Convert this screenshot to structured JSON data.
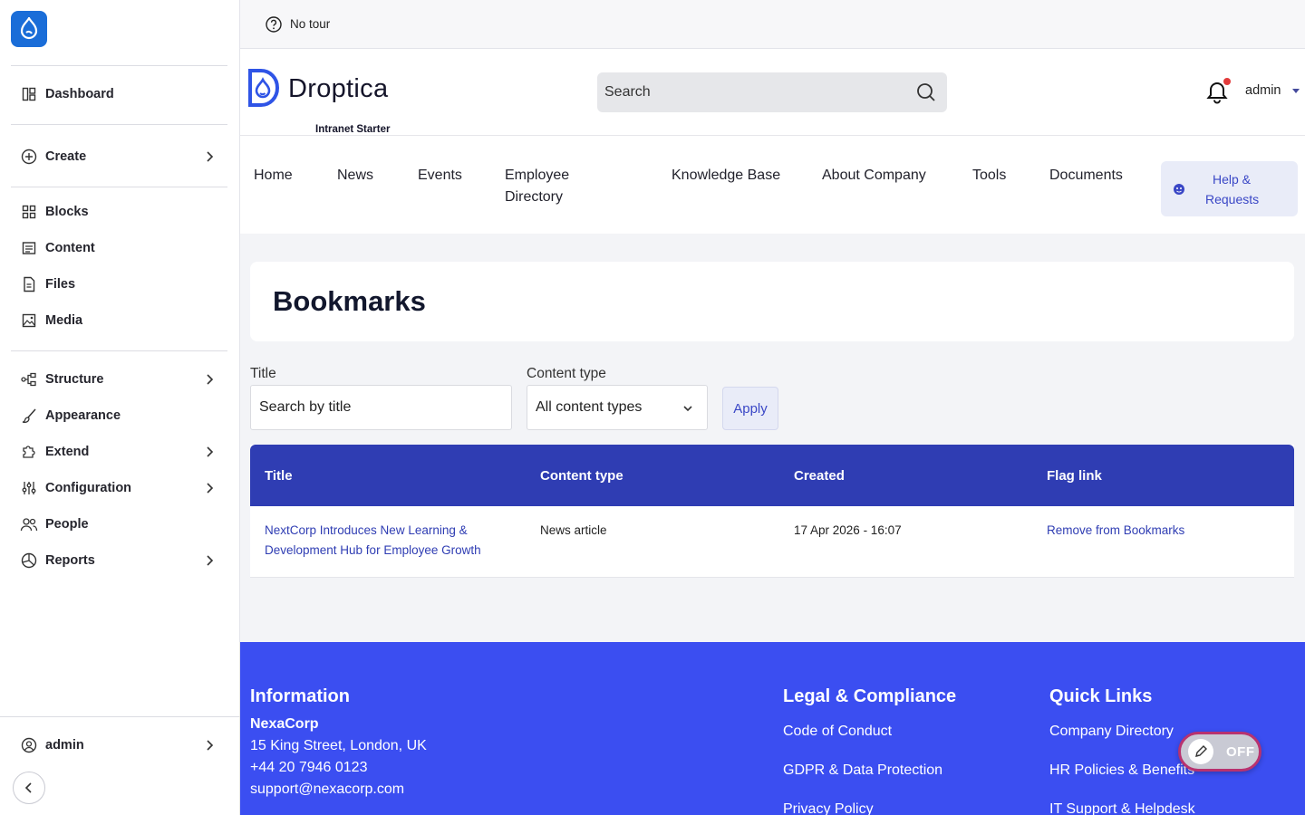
{
  "sidebar": {
    "items": [
      {
        "label": "Dashboard",
        "icon": "dashboard-icon"
      },
      {
        "label": "Create",
        "icon": "plus-circle-icon"
      },
      {
        "label": "Blocks",
        "icon": "blocks-icon"
      },
      {
        "label": "Content",
        "icon": "content-icon"
      },
      {
        "label": "Files",
        "icon": "file-icon"
      },
      {
        "label": "Media",
        "icon": "media-icon"
      },
      {
        "label": "Structure",
        "icon": "structure-icon"
      },
      {
        "label": "Appearance",
        "icon": "brush-icon"
      },
      {
        "label": "Extend",
        "icon": "puzzle-icon"
      },
      {
        "label": "Configuration",
        "icon": "sliders-icon"
      },
      {
        "label": "People",
        "icon": "people-icon"
      },
      {
        "label": "Reports",
        "icon": "reports-icon"
      }
    ],
    "user": {
      "label": "admin",
      "icon": "user-circle-icon"
    }
  },
  "topbar": {
    "tour_label": "No tour"
  },
  "header": {
    "brand_name": "Droptica",
    "brand_subtitle": "Intranet Starter",
    "search_placeholder": "Search",
    "username": "admin"
  },
  "nav": {
    "links": [
      "Home",
      "News",
      "Events",
      "Employee Directory",
      "Knowledge Base",
      "About Company",
      "Tools",
      "Documents"
    ],
    "help_label": "Help & Requests"
  },
  "page": {
    "title": "Bookmarks",
    "filters": {
      "title_label": "Title",
      "title_placeholder": "Search by title",
      "content_type_label": "Content type",
      "content_type_value": "All content types",
      "apply_label": "Apply"
    },
    "table": {
      "headers": [
        "Title",
        "Content type",
        "Created",
        "Flag link"
      ],
      "rows": [
        {
          "title": "NextCorp Introduces New Learning & Development Hub for Employee Growth",
          "content_type": "News article",
          "created": "17 Apr 2026 - 16:07",
          "flag_link": "Remove from Bookmarks"
        }
      ]
    }
  },
  "footer": {
    "information": {
      "heading": "Information",
      "company": "NexaCorp",
      "address": "15 King Street, London, UK",
      "phone": "+44 20 7946 0123",
      "email": "support@nexacorp.com"
    },
    "legal": {
      "heading": "Legal & Compliance",
      "links": [
        "Code of Conduct",
        "GDPR & Data Protection",
        "Privacy Policy"
      ]
    },
    "quick_links": {
      "heading": "Quick Links",
      "links": [
        "Company Directory",
        "HR Policies & Benefits",
        "IT Support & Helpdesk"
      ]
    }
  },
  "edit_toggle": {
    "state_label": "OFF"
  },
  "colors": {
    "primary": "#2f3db3",
    "footer_bg": "#3b4ef1",
    "drupal_blue": "#1a6dd8",
    "notification_dot": "#e23b3b"
  }
}
